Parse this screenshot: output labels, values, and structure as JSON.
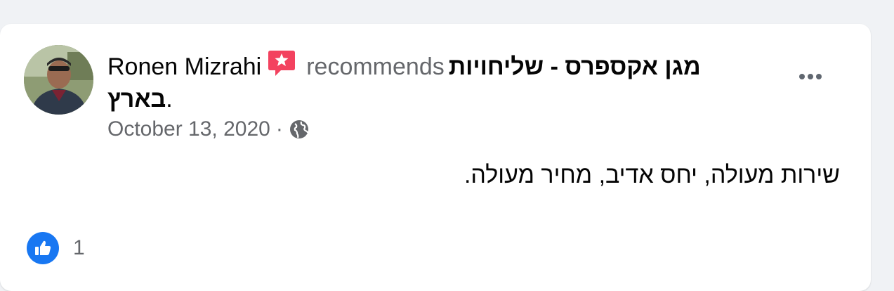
{
  "post": {
    "author": "Ronen Mizrahi",
    "verb": "recommends",
    "page_name_part1": "מגן אקספרס - שליחויות",
    "page_name_part2": "בארץ",
    "page_name_suffix": ".",
    "date": "October 13, 2020",
    "separator": "·",
    "privacy_icon": "globe-icon",
    "recommend_badge_icon": "star-speech-bubble-icon",
    "body_text": "שירות מעולה, יחס אדיב, מחיר מעולה.",
    "reactions": {
      "icon": "thumbs-up-icon",
      "count": "1"
    },
    "more_icon": "ellipsis-icon"
  },
  "colors": {
    "background": "#f0f2f5",
    "card": "#ffffff",
    "text_primary": "#050505",
    "text_secondary": "#65676b",
    "recommend_badge": "#f3425f",
    "like_blue": "#1877f2"
  }
}
